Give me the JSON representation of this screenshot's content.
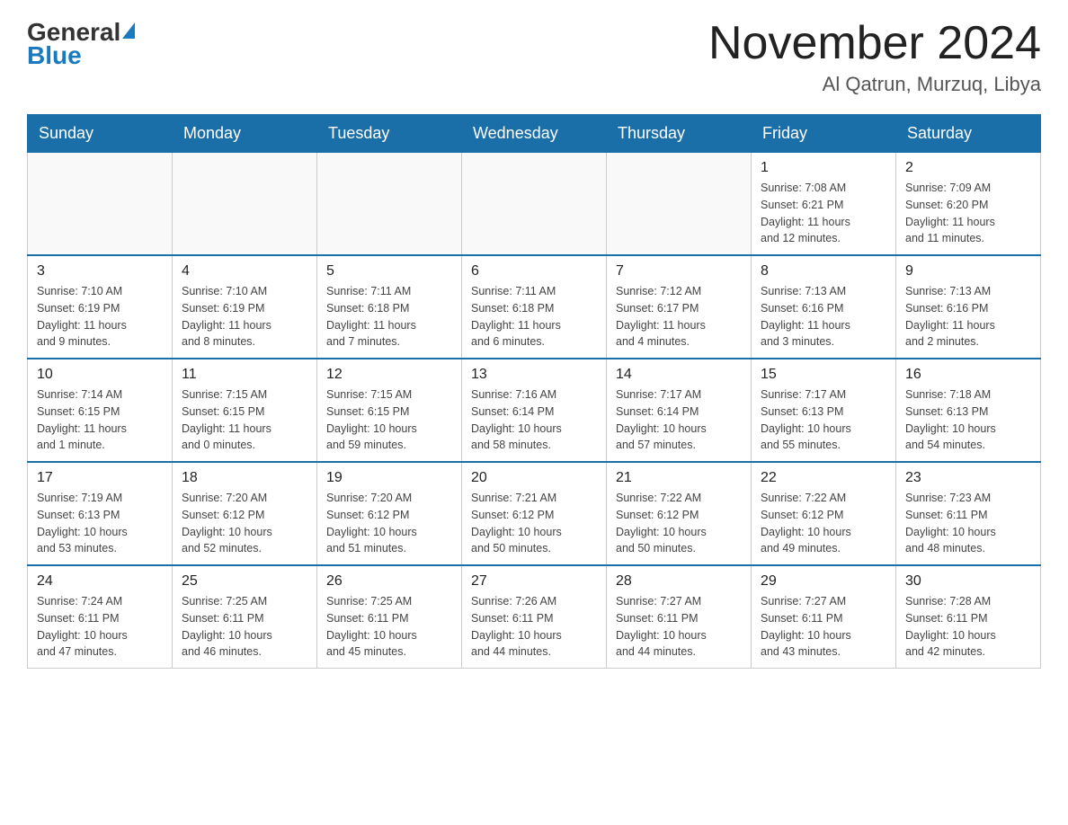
{
  "header": {
    "logo": {
      "general": "General",
      "triangle": "▲",
      "blue": "Blue"
    },
    "title": "November 2024",
    "location": "Al Qatrun, Murzuq, Libya"
  },
  "calendar": {
    "days_of_week": [
      "Sunday",
      "Monday",
      "Tuesday",
      "Wednesday",
      "Thursday",
      "Friday",
      "Saturday"
    ],
    "weeks": [
      [
        {
          "day": "",
          "info": ""
        },
        {
          "day": "",
          "info": ""
        },
        {
          "day": "",
          "info": ""
        },
        {
          "day": "",
          "info": ""
        },
        {
          "day": "",
          "info": ""
        },
        {
          "day": "1",
          "info": "Sunrise: 7:08 AM\nSunset: 6:21 PM\nDaylight: 11 hours\nand 12 minutes."
        },
        {
          "day": "2",
          "info": "Sunrise: 7:09 AM\nSunset: 6:20 PM\nDaylight: 11 hours\nand 11 minutes."
        }
      ],
      [
        {
          "day": "3",
          "info": "Sunrise: 7:10 AM\nSunset: 6:19 PM\nDaylight: 11 hours\nand 9 minutes."
        },
        {
          "day": "4",
          "info": "Sunrise: 7:10 AM\nSunset: 6:19 PM\nDaylight: 11 hours\nand 8 minutes."
        },
        {
          "day": "5",
          "info": "Sunrise: 7:11 AM\nSunset: 6:18 PM\nDaylight: 11 hours\nand 7 minutes."
        },
        {
          "day": "6",
          "info": "Sunrise: 7:11 AM\nSunset: 6:18 PM\nDaylight: 11 hours\nand 6 minutes."
        },
        {
          "day": "7",
          "info": "Sunrise: 7:12 AM\nSunset: 6:17 PM\nDaylight: 11 hours\nand 4 minutes."
        },
        {
          "day": "8",
          "info": "Sunrise: 7:13 AM\nSunset: 6:16 PM\nDaylight: 11 hours\nand 3 minutes."
        },
        {
          "day": "9",
          "info": "Sunrise: 7:13 AM\nSunset: 6:16 PM\nDaylight: 11 hours\nand 2 minutes."
        }
      ],
      [
        {
          "day": "10",
          "info": "Sunrise: 7:14 AM\nSunset: 6:15 PM\nDaylight: 11 hours\nand 1 minute."
        },
        {
          "day": "11",
          "info": "Sunrise: 7:15 AM\nSunset: 6:15 PM\nDaylight: 11 hours\nand 0 minutes."
        },
        {
          "day": "12",
          "info": "Sunrise: 7:15 AM\nSunset: 6:15 PM\nDaylight: 10 hours\nand 59 minutes."
        },
        {
          "day": "13",
          "info": "Sunrise: 7:16 AM\nSunset: 6:14 PM\nDaylight: 10 hours\nand 58 minutes."
        },
        {
          "day": "14",
          "info": "Sunrise: 7:17 AM\nSunset: 6:14 PM\nDaylight: 10 hours\nand 57 minutes."
        },
        {
          "day": "15",
          "info": "Sunrise: 7:17 AM\nSunset: 6:13 PM\nDaylight: 10 hours\nand 55 minutes."
        },
        {
          "day": "16",
          "info": "Sunrise: 7:18 AM\nSunset: 6:13 PM\nDaylight: 10 hours\nand 54 minutes."
        }
      ],
      [
        {
          "day": "17",
          "info": "Sunrise: 7:19 AM\nSunset: 6:13 PM\nDaylight: 10 hours\nand 53 minutes."
        },
        {
          "day": "18",
          "info": "Sunrise: 7:20 AM\nSunset: 6:12 PM\nDaylight: 10 hours\nand 52 minutes."
        },
        {
          "day": "19",
          "info": "Sunrise: 7:20 AM\nSunset: 6:12 PM\nDaylight: 10 hours\nand 51 minutes."
        },
        {
          "day": "20",
          "info": "Sunrise: 7:21 AM\nSunset: 6:12 PM\nDaylight: 10 hours\nand 50 minutes."
        },
        {
          "day": "21",
          "info": "Sunrise: 7:22 AM\nSunset: 6:12 PM\nDaylight: 10 hours\nand 50 minutes."
        },
        {
          "day": "22",
          "info": "Sunrise: 7:22 AM\nSunset: 6:12 PM\nDaylight: 10 hours\nand 49 minutes."
        },
        {
          "day": "23",
          "info": "Sunrise: 7:23 AM\nSunset: 6:11 PM\nDaylight: 10 hours\nand 48 minutes."
        }
      ],
      [
        {
          "day": "24",
          "info": "Sunrise: 7:24 AM\nSunset: 6:11 PM\nDaylight: 10 hours\nand 47 minutes."
        },
        {
          "day": "25",
          "info": "Sunrise: 7:25 AM\nSunset: 6:11 PM\nDaylight: 10 hours\nand 46 minutes."
        },
        {
          "day": "26",
          "info": "Sunrise: 7:25 AM\nSunset: 6:11 PM\nDaylight: 10 hours\nand 45 minutes."
        },
        {
          "day": "27",
          "info": "Sunrise: 7:26 AM\nSunset: 6:11 PM\nDaylight: 10 hours\nand 44 minutes."
        },
        {
          "day": "28",
          "info": "Sunrise: 7:27 AM\nSunset: 6:11 PM\nDaylight: 10 hours\nand 44 minutes."
        },
        {
          "day": "29",
          "info": "Sunrise: 7:27 AM\nSunset: 6:11 PM\nDaylight: 10 hours\nand 43 minutes."
        },
        {
          "day": "30",
          "info": "Sunrise: 7:28 AM\nSunset: 6:11 PM\nDaylight: 10 hours\nand 42 minutes."
        }
      ]
    ]
  }
}
